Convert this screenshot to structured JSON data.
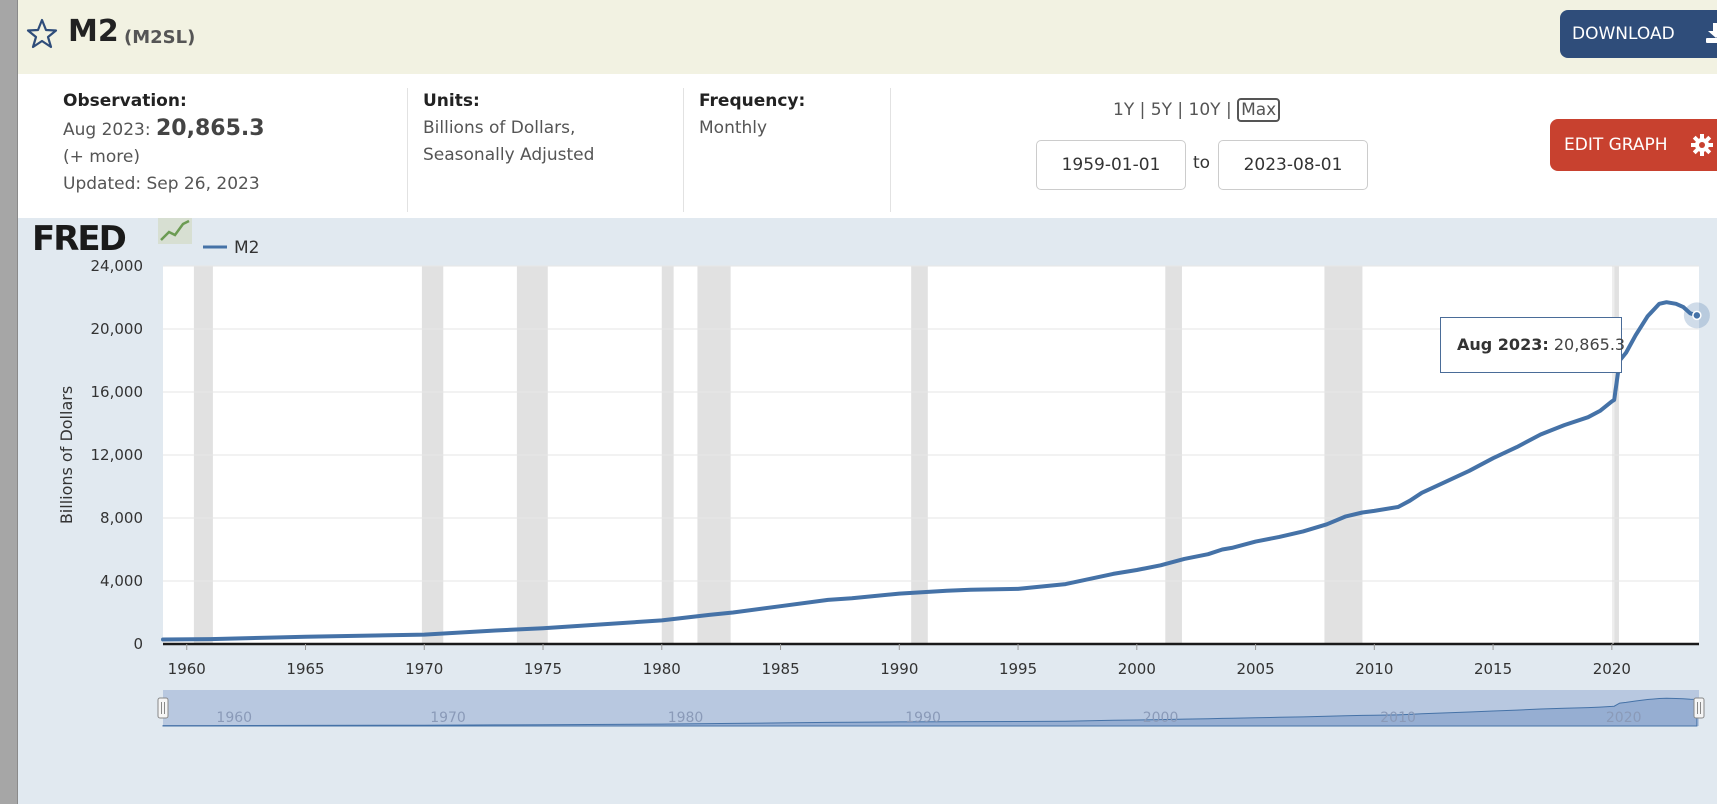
{
  "header": {
    "title": "M2",
    "series_id": "(M2SL)",
    "download_label": "DOWNLOAD"
  },
  "meta": {
    "observation_label": "Observation:",
    "observation_date": "Aug 2023:",
    "observation_value": "20,865.3",
    "more_link": "(+ more)",
    "updated": "Updated: Sep 26, 2023",
    "units_label": "Units:",
    "units_line1": "Billions of Dollars,",
    "units_line2": "Seasonally Adjusted",
    "frequency_label": "Frequency:",
    "frequency_value": "Monthly"
  },
  "range": {
    "y1": "1Y",
    "y5": "5Y",
    "y10": "10Y",
    "max": "Max",
    "sep": "|",
    "start": "1959-01-01",
    "to": "to",
    "end": "2023-08-01",
    "edit_label": "EDIT GRAPH"
  },
  "colors": {
    "line": "#4572a7",
    "recession": "#e1e1e1",
    "download_button": "#2f4d7a",
    "edit_button": "#c8412f",
    "graph_background": "#e1e9f0"
  },
  "chart_data": {
    "type": "line",
    "logo": "FRED",
    "ylabel": "Billions of Dollars",
    "xlim": [
      1959.0,
      2023.67
    ],
    "ylim": [
      0,
      24000
    ],
    "y_ticks": [
      0,
      4000,
      8000,
      12000,
      16000,
      20000,
      24000
    ],
    "y_tick_labels": [
      "0",
      "4,000",
      "8,000",
      "12,000",
      "16,000",
      "20,000",
      "24,000"
    ],
    "x_ticks": [
      1960,
      1965,
      1970,
      1975,
      1980,
      1985,
      1990,
      1995,
      2000,
      2005,
      2010,
      2015,
      2020
    ],
    "x_tick_labels": [
      "1960",
      "1965",
      "1970",
      "1975",
      "1980",
      "1985",
      "1990",
      "1995",
      "2000",
      "2005",
      "2010",
      "2015",
      "2020"
    ],
    "navigator_labels": [
      "1960",
      "1970",
      "1980",
      "1990",
      "2000",
      "2010",
      "2020"
    ],
    "grid": true,
    "legend_position": "top-left",
    "recessions": [
      [
        1960.3,
        1961.1
      ],
      [
        1969.9,
        1970.8
      ],
      [
        1973.9,
        1975.2
      ],
      [
        1980.0,
        1980.5
      ],
      [
        1981.5,
        1982.9
      ],
      [
        1990.5,
        1991.2
      ],
      [
        2001.2,
        2001.9
      ],
      [
        2007.9,
        2009.5
      ],
      [
        2020.1,
        2020.3
      ]
    ],
    "series": [
      {
        "name": "M2",
        "x": [
          1959.0,
          1961.0,
          1965.0,
          1970.0,
          1973.0,
          1975.0,
          1980.0,
          1982.0,
          1983.0,
          1985.0,
          1987.0,
          1988.0,
          1990.0,
          1992.0,
          1993.0,
          1995.0,
          1997.0,
          1999.0,
          2000.0,
          2001.0,
          2002.0,
          2003.0,
          2003.6,
          2004.0,
          2005.0,
          2006.0,
          2007.0,
          2008.0,
          2008.8,
          2009.5,
          2010.0,
          2011.0,
          2011.5,
          2012.0,
          2013.0,
          2014.0,
          2015.0,
          2016.0,
          2017.0,
          2018.0,
          2019.0,
          2019.5,
          2020.0,
          2020.1,
          2020.33,
          2020.6,
          2021.0,
          2021.5,
          2022.0,
          2022.3,
          2022.7,
          2023.0,
          2023.3,
          2023.58
        ],
        "values": [
          287,
          310,
          460,
          600,
          860,
          1000,
          1500,
          1850,
          2000,
          2400,
          2800,
          2900,
          3200,
          3380,
          3450,
          3500,
          3800,
          4450,
          4700,
          5000,
          5400,
          5700,
          6000,
          6100,
          6500,
          6800,
          7150,
          7600,
          8100,
          8350,
          8450,
          8700,
          9100,
          9600,
          10300,
          11000,
          11800,
          12500,
          13300,
          13900,
          14400,
          14800,
          15400,
          15500,
          18000,
          18500,
          19600,
          20800,
          21600,
          21700,
          21600,
          21400,
          21000,
          20865
        ]
      }
    ],
    "tooltip": {
      "label": "Aug 2023:",
      "value": "20,865.3",
      "x": 2023.58,
      "y": 20865.3
    }
  }
}
